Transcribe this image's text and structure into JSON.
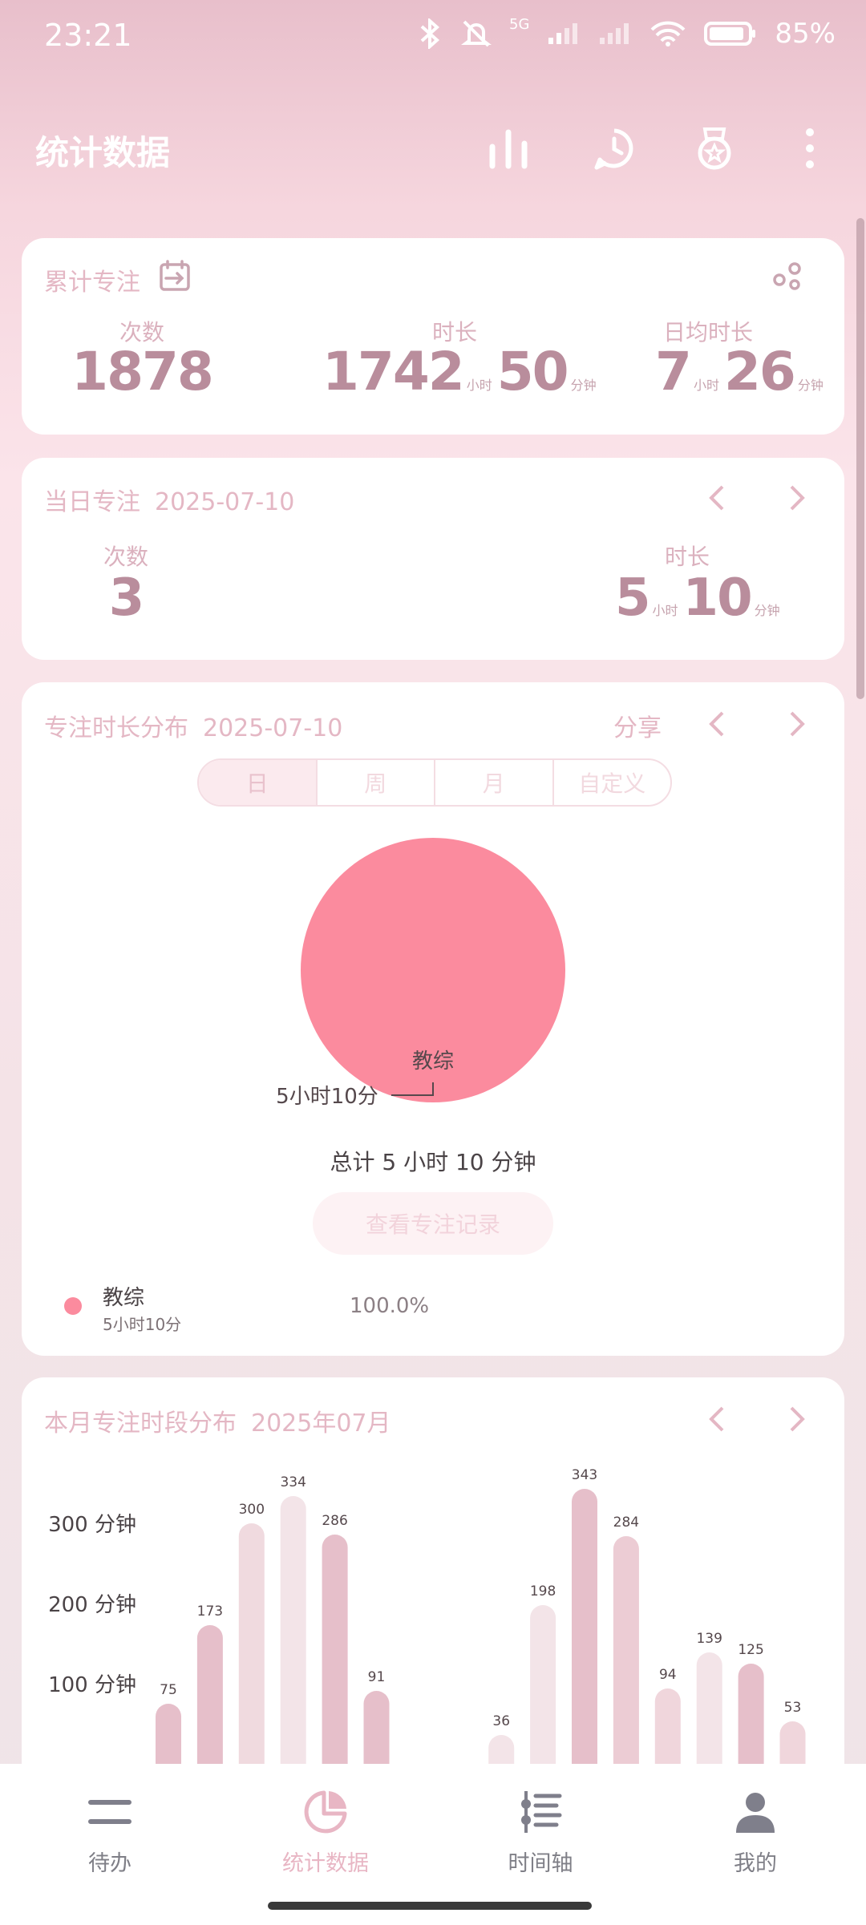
{
  "status_bar": {
    "time": "23:21",
    "network": "5G",
    "battery": "85%"
  },
  "app_bar": {
    "title": "统计数据",
    "icons": [
      "bar-chart-icon",
      "clock-icon",
      "medal-icon",
      "more-vert-icon"
    ]
  },
  "cumulative": {
    "title": "累计专注",
    "count_label": "次数",
    "count": "1878",
    "duration_label": "时长",
    "duration_hours": "1742",
    "duration_minutes": "50",
    "avg_label": "日均时长",
    "avg_hours": "7",
    "avg_minutes": "26",
    "unit_hour": "小时",
    "unit_minute": "分钟"
  },
  "daily": {
    "title": "当日专注",
    "date": "2025-07-10",
    "count_label": "次数",
    "count": "3",
    "duration_label": "时长",
    "duration_hours": "5",
    "duration_minutes": "10",
    "unit_hour": "小时",
    "unit_minute": "分钟"
  },
  "distribution": {
    "title": "专注时长分布",
    "date": "2025-07-10",
    "share": "分享",
    "tabs": [
      "日",
      "周",
      "月",
      "自定义"
    ],
    "active_tab": "日",
    "total": "总计 5 小时 10 分钟",
    "records_button": "查看专注记录",
    "legend": {
      "name": "教综",
      "duration": "5小时10分",
      "percent": "100.0%",
      "color": "#fb8b9e"
    }
  },
  "chart_data": [
    {
      "type": "pie",
      "slices": [
        {
          "label": "教综",
          "value": 310,
          "display": "5小时10分",
          "color": "#fb8b9e"
        }
      ]
    },
    {
      "type": "bar",
      "title": "本月专注时段分布",
      "subtitle": "2025年07月",
      "ylabel": "",
      "ytick_labels": [
        "300 分钟",
        "200 分钟",
        "100 分钟"
      ],
      "yticks": [
        300,
        200,
        100
      ],
      "ylim": [
        0,
        360
      ],
      "values": [
        75,
        173,
        300,
        334,
        286,
        91,
        null,
        null,
        36,
        198,
        343,
        284,
        94,
        139,
        125,
        53
      ],
      "colors": [
        "#e6bfca",
        "#e6bfca",
        "#f0dadf",
        "#f3e4e8",
        "#e6bfca",
        "#e6bfca",
        "",
        "",
        "#f3e4e8",
        "#f3e4e8",
        "#e6bfca",
        "#ecccd4",
        "#f0d6dc",
        "#f3e4e8",
        "#e6bfca",
        "#f0d6dc"
      ]
    }
  ],
  "hourly": {
    "title": "本月专注时段分布",
    "month": "2025年07月"
  },
  "bottom_nav": [
    {
      "label": "待办",
      "icon": "menu-icon"
    },
    {
      "label": "统计数据",
      "icon": "pie-chart-icon",
      "active": true
    },
    {
      "label": "时间轴",
      "icon": "timeline-icon"
    },
    {
      "label": "我的",
      "icon": "person-icon"
    }
  ],
  "colors": {
    "accent": "#fb8b9e",
    "card_text": "#b98d9c",
    "label": "#e4b7c4"
  }
}
